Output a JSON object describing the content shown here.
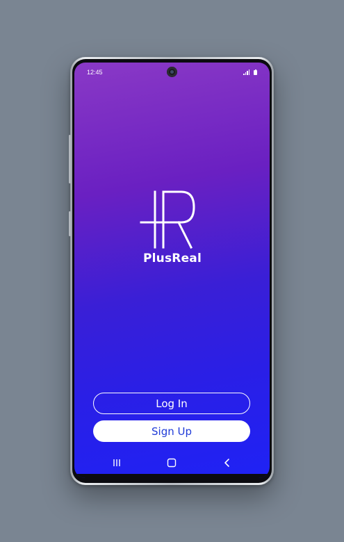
{
  "status_bar": {
    "time": "12:45",
    "icons": [
      "signal-icon",
      "battery-icon"
    ]
  },
  "brand": {
    "name": "PlusReal",
    "logo_icon": "plus-r-logo-icon"
  },
  "actions": {
    "login_label": "Log In",
    "signup_label": "Sign Up"
  },
  "navigation": {
    "icons": [
      "recent-apps-icon",
      "home-icon",
      "back-icon"
    ]
  },
  "colors": {
    "gradient_top": "#8a39c6",
    "gradient_bottom": "#1f22f5",
    "signup_text": "#1f3bd8",
    "background": "#7a8592"
  }
}
